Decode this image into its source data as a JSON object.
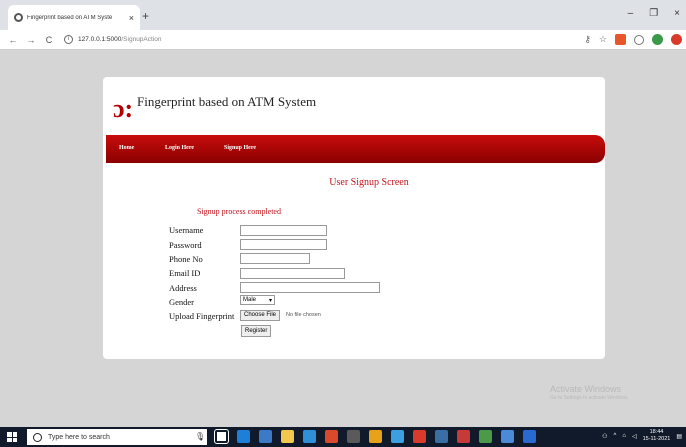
{
  "browser": {
    "tab_title": "Fingerprint based on ATM Syste",
    "tab_close": "×",
    "new_tab": "+",
    "nav": {
      "back": "←",
      "forward": "→",
      "reload": "C"
    },
    "url_host": "127.0.0.1:5000",
    "url_path": "/SignupAction",
    "window_controls": {
      "minimize": "–",
      "maximize": "❐",
      "close": "×"
    }
  },
  "site": {
    "logo": "ɔ:",
    "title": "Fingerprint based on ATM System",
    "nav": [
      "Home",
      "Login Here",
      "Signup Here"
    ]
  },
  "form": {
    "screen_title": "User Signup Screen",
    "status_message": "Signup process completed",
    "labels": {
      "username": "Username",
      "password": "Password",
      "phone": "Phone No",
      "email": "Email ID",
      "address": "Address",
      "gender": "Gender",
      "fingerprint": "Upload Fingerprint"
    },
    "values": {
      "username": "",
      "password": "",
      "phone": "",
      "email": "",
      "address": ""
    },
    "gender_selected": "Male",
    "file_button": "Choose File",
    "file_status": "No file chosen",
    "register_button": "Register"
  },
  "watermark": {
    "title": "Activate Windows",
    "subtitle": "Go to Settings to activate Windows."
  },
  "taskbar": {
    "search_placeholder": "Type here to search",
    "time": "18:44",
    "date": "15-11-2021"
  },
  "colors": {
    "accent_red": "#c0141c",
    "navbar_red": "#b00000",
    "taskbar": "#111a2b"
  }
}
